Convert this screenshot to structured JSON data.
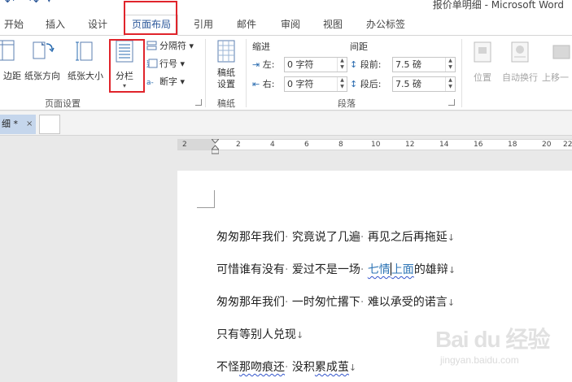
{
  "window": {
    "title": "报价单明细 - Microsoft Word"
  },
  "ribbon_tabs": [
    "开始",
    "插入",
    "设计",
    "页面布局",
    "引用",
    "邮件",
    "审阅",
    "视图",
    "办公标签"
  ],
  "active_tab": "页面布局",
  "page_setup": {
    "margins": "边距",
    "orientation": "纸张方向",
    "size": "纸张大小",
    "columns": "分栏",
    "breaks": "分隔符",
    "line_numbers": "行号",
    "hyphenation": "断字",
    "group_label": "页面设置"
  },
  "manuscript": {
    "button": "稿纸\n设置",
    "line1": "稿纸",
    "line2": "设置",
    "group_label": "稿纸"
  },
  "paragraph": {
    "indent_label": "缩进",
    "spacing_label": "间距",
    "left_label": "左:",
    "right_label": "右:",
    "before_label": "段前:",
    "after_label": "段后:",
    "left_value": "0 字符",
    "right_value": "0 字符",
    "before_value": "7.5 磅",
    "after_value": "7.5 磅",
    "group_label": "段落"
  },
  "arrange": {
    "position": "位置",
    "wrap": "自动换行",
    "bring_forward": "上移一"
  },
  "doc_tab": {
    "label": "细 *",
    "close": "×"
  },
  "ruler_numbers": [
    "2",
    "2",
    "4",
    "6",
    "8",
    "10",
    "12",
    "14",
    "16",
    "18",
    "20",
    "22"
  ],
  "document": {
    "lines": [
      {
        "a": "匆匆那年我们",
        "b": "究竟说了几遍",
        "c": "再见之后再拖延"
      },
      {
        "a": "可惜谁有没有",
        "b": "爱过不是一场",
        "c1": "七情",
        "c2": "上面",
        "c3": "的雄辩"
      },
      {
        "a": "匆匆那年我们",
        "b": "一时匆忙撂下",
        "c": "难以承受的诺言"
      },
      {
        "a": "只有等别人兑现"
      },
      {
        "a1": "不怪",
        "a2": "那吻痕还",
        "b1": "没积",
        "b2": "累成茧"
      }
    ]
  },
  "watermark": {
    "brand": "Bai du 经验",
    "url": "jingyan.baidu.com"
  },
  "colors": {
    "accent": "#2b579a",
    "highlight": "#e0242b",
    "link_text": "#2e75b6"
  }
}
